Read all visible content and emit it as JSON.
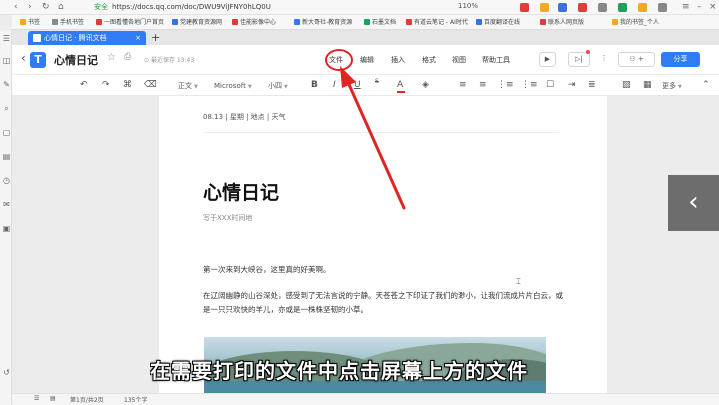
{
  "browser": {
    "secure_label": "安全",
    "url": "https://docs.qq.com/doc/DWU9ViJFNY0hLQ0U",
    "zoom": "110%"
  },
  "bookmarks": [
    {
      "label": "书签",
      "color": "#f5a623"
    },
    {
      "label": "手机书签",
      "color": "#888888"
    },
    {
      "label": "一图看懂各地门户首页",
      "color": "#e03c3c"
    },
    {
      "label": "党建教育资源网",
      "color": "#3c6fe0"
    },
    {
      "label": "佳能影像中心",
      "color": "#e03c3c"
    },
    {
      "label": "新大哥社-教育资源",
      "color": "#2f7cf6"
    },
    {
      "label": "石墨文档",
      "color": "#1aa35c"
    },
    {
      "label": "有道云笔记 - AI时代",
      "color": "#e03c3c"
    },
    {
      "label": "百度翻译在线",
      "color": "#3c6fe0"
    },
    {
      "label": "联系人网页版",
      "color": "#e03c3c"
    },
    {
      "label": "我的书签_个人",
      "color": "#f5a623"
    }
  ],
  "tab": {
    "title": "心情日记 · 腾讯文档",
    "add": "+"
  },
  "doc_header": {
    "back": "‹",
    "logo_letter": "T",
    "title": "心情日记",
    "saved_status": "最近保存 13:43",
    "menus": {
      "file": "文件",
      "edit": "编辑",
      "insert": "插入",
      "format": "格式",
      "view": "视图",
      "tools": "帮助工具"
    },
    "collab_label": "+",
    "share_label": "分享"
  },
  "toolbar": {
    "style": "正文",
    "font": "Microsoft",
    "size": "小四",
    "bold": "B",
    "italic": "I",
    "underline": "U",
    "strike": "S",
    "color": "A",
    "more": "更多"
  },
  "document": {
    "meta_line": "08.13  |  星期  |  地点  |  天气",
    "heading": "心情日记",
    "subtitle": "写于XXX时间地",
    "para1": "第一次来到大峡谷，这里真的好美啊。",
    "para2": "在辽阔幽静的山谷深处，感受到了无法言说的宁静。天苍苍之下印证了我们的渺小，让我们流成片片白云，或是一只只欢快的羊儿，亦或是一株株坚韧的小草。"
  },
  "status_bar": {
    "page": "第1页/共2页",
    "words": "135个字"
  },
  "caption": "在需要打印的文件中点击屏幕上方的文件",
  "colors": {
    "accent": "#2f7cf6",
    "annotation": "#e02424"
  }
}
